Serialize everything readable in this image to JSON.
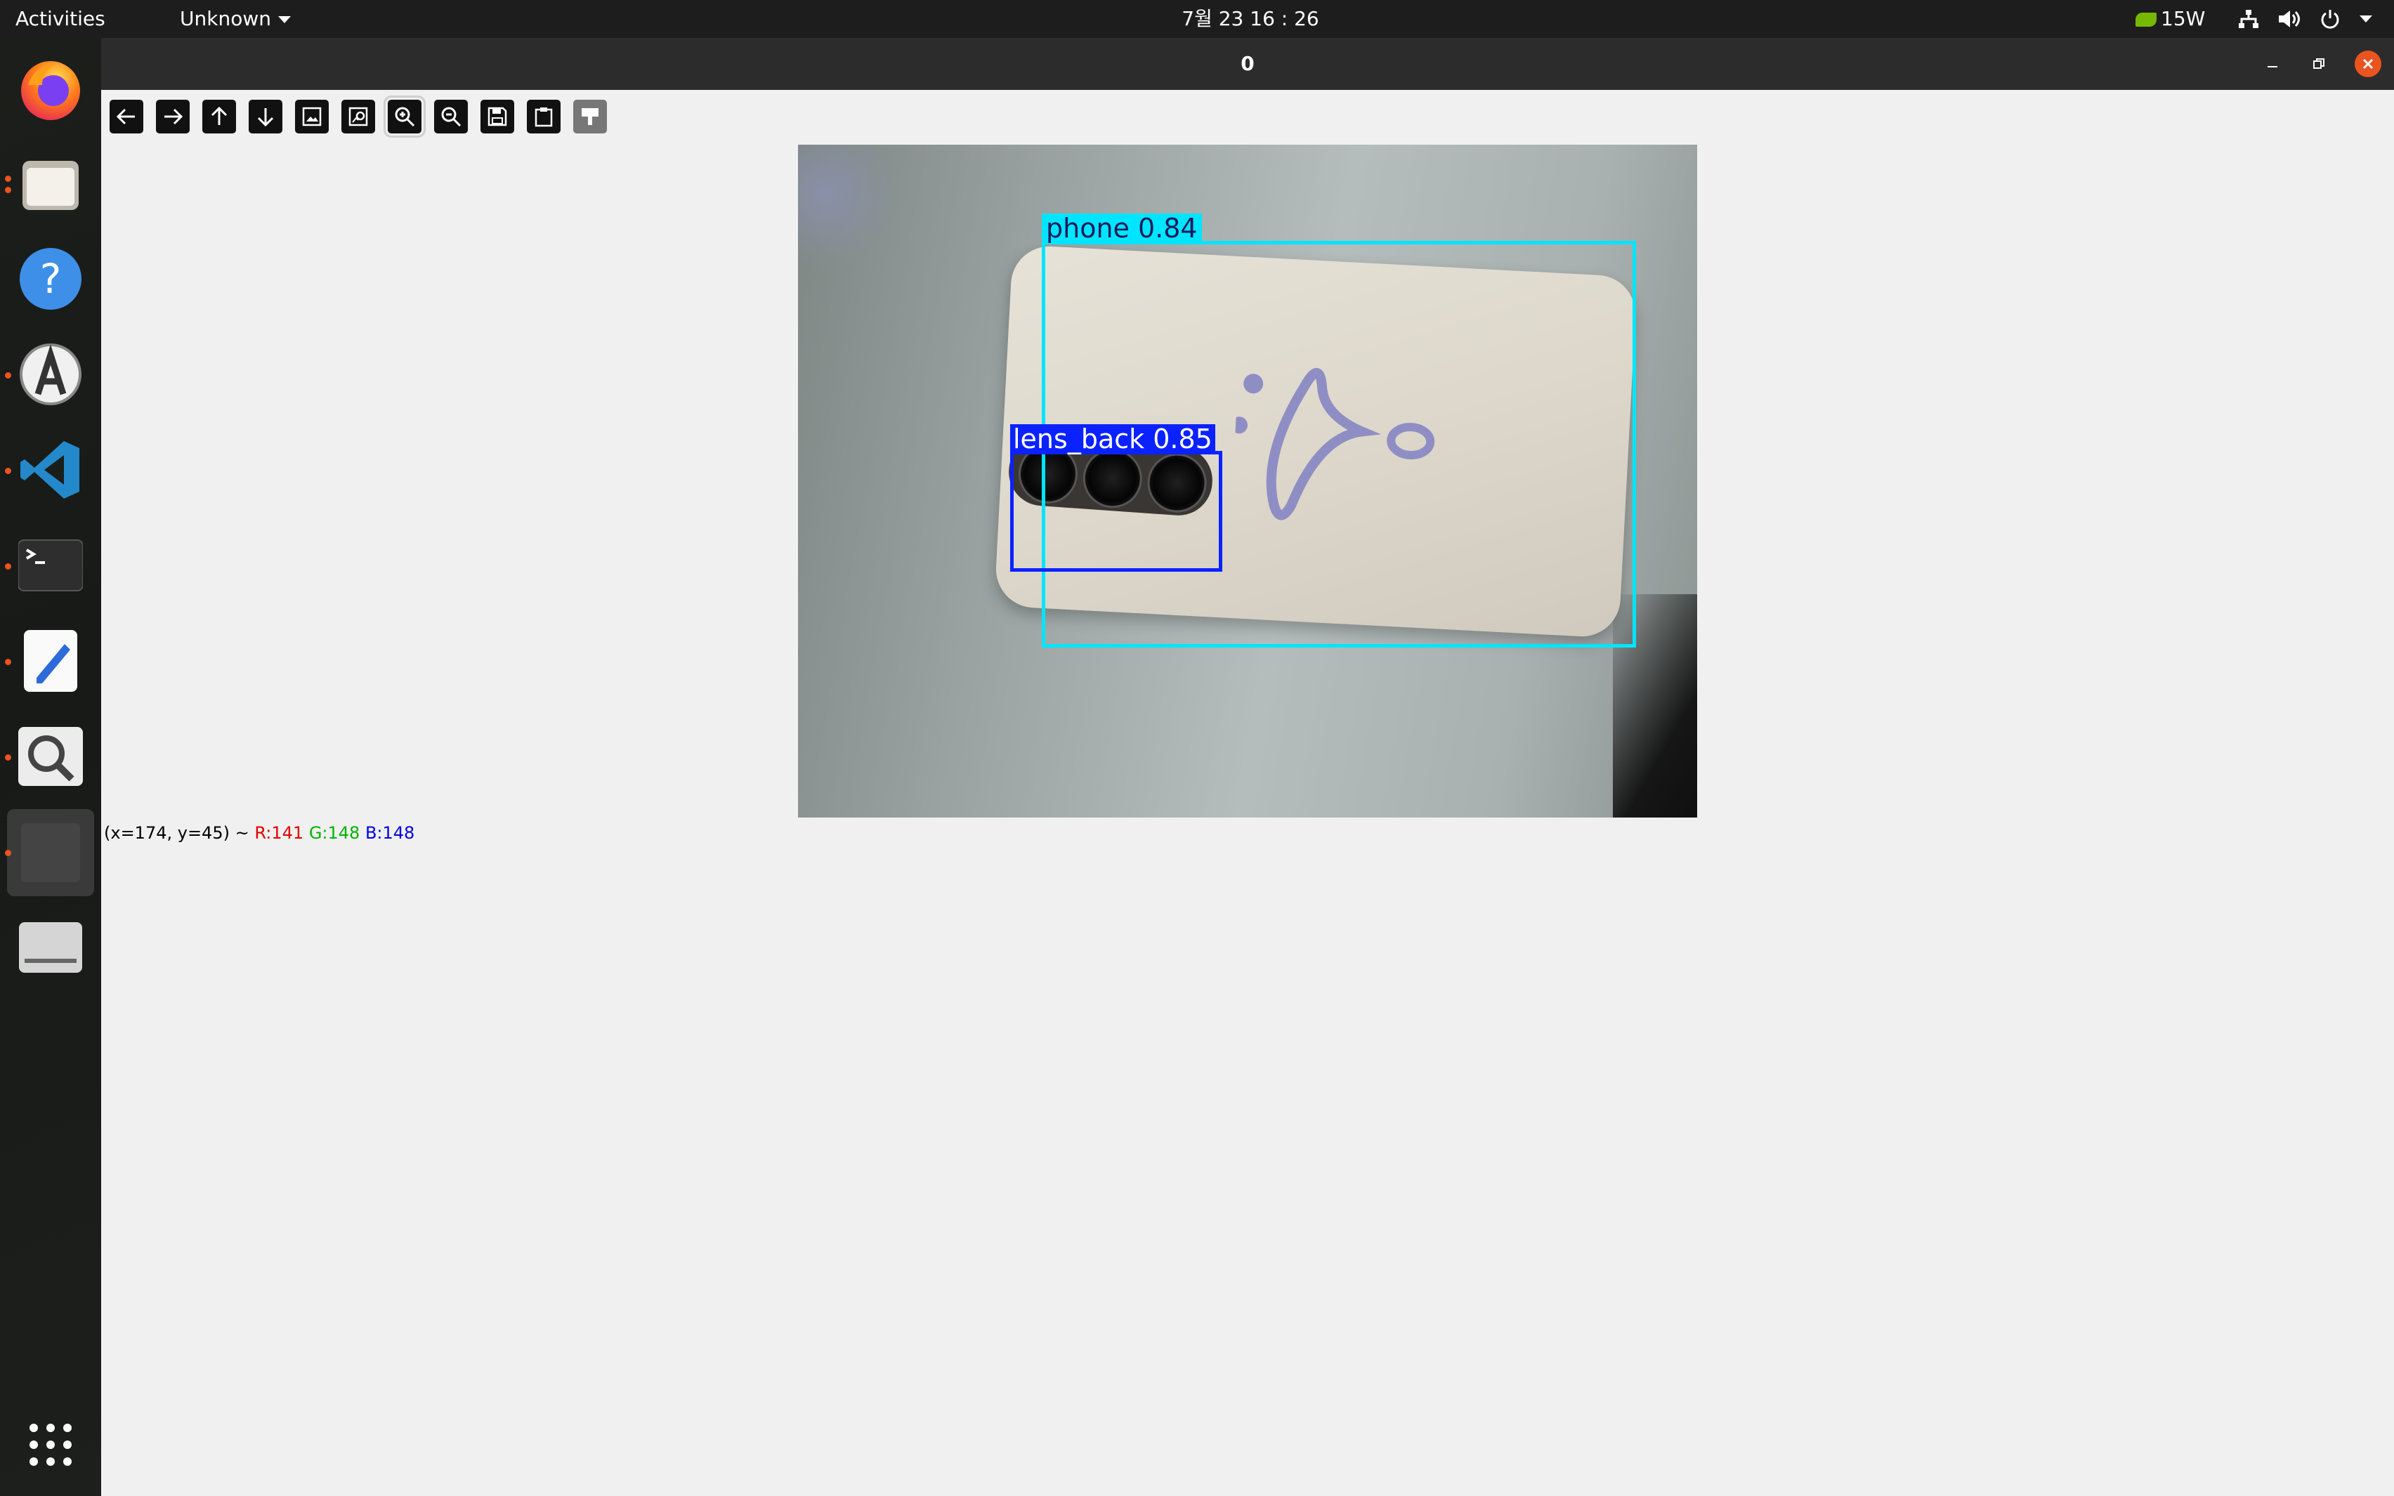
{
  "topbar": {
    "activities": "Activities",
    "app_menu": "Unknown",
    "clock": "7월 23  16 : 26",
    "power": "15W"
  },
  "dock": {
    "apps": [
      "Firefox",
      "Files",
      "Help",
      "Ubuntu Software",
      "Visual Studio Code",
      "Terminal",
      "Text Editor",
      "Image Viewer",
      "Active window",
      "Disk drive",
      "Show Applications"
    ]
  },
  "window": {
    "title": "0",
    "toolbar": [
      "back",
      "forward",
      "up",
      "down",
      "fit-image",
      "fit-window",
      "zoom-in",
      "zoom-out",
      "save",
      "copy",
      "properties"
    ]
  },
  "detections": [
    {
      "label": "phone 0.84",
      "color": "#00e5ff"
    },
    {
      "label": "lens_back 0.85",
      "color": "#0b22ff"
    }
  ],
  "status": {
    "coords": "(x=174, y=45) ~ ",
    "r": "R:141",
    "g": "G:148",
    "b": "B:148"
  }
}
